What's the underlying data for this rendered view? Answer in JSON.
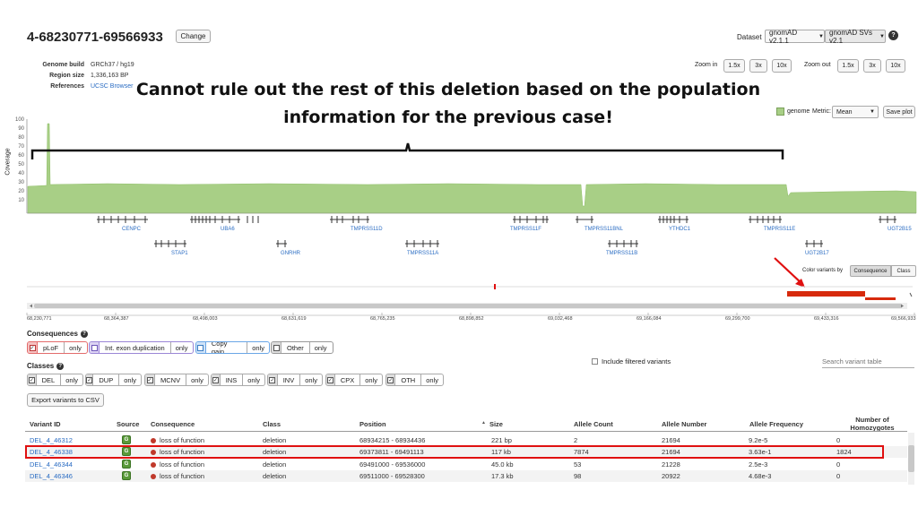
{
  "header": {
    "region_title": "4-68230771-69566933",
    "change_label": "Change",
    "dataset_label": "Dataset",
    "dataset_value": "gnomAD v2.1.1",
    "sv_dataset_value": "gnomAD SVs v2.1",
    "help_glyph": "?"
  },
  "meta": {
    "genome_build_label": "Genome build",
    "genome_build_value": "GRCh37 / hg19",
    "region_size_label": "Region size",
    "region_size_value": "1,336,163 BP",
    "references_label": "References",
    "references_value": "UCSC Browser"
  },
  "zoom": {
    "zoom_in_label": "Zoom in",
    "zoom_out_label": "Zoom out",
    "levels": [
      "1.5x",
      "3x",
      "10x"
    ]
  },
  "overlay": {
    "caption_line1": "Cannot rule out the rest of this deletion based on the population",
    "caption_line2": "information for the previous case!"
  },
  "coverage": {
    "axis_label": "Coverage",
    "y_ticks": [
      "100",
      "90",
      "80",
      "70",
      "60",
      "50",
      "40",
      "30",
      "20",
      "10"
    ],
    "legend_label": "genome",
    "metric_label": "Metric:",
    "metric_value": "Mean",
    "save_plot_label": "Save plot",
    "colors": {
      "fill": "#a8cf86",
      "stroke": "#8fbf68"
    }
  },
  "genes": {
    "row1": [
      "CENPC",
      "UBA6",
      "TMPRSS11D",
      "TMPRSS11F",
      "TMPRSS11BNL",
      "YTHDC1",
      "TMPRSS11E",
      "UGT2B15"
    ],
    "row2": [
      "STAP1",
      "GNRHR",
      "TMPRSS11A",
      "TMPRSS11B",
      "UGT2B17"
    ]
  },
  "track": {
    "color_variants_label": "Color variants by",
    "consequence_toggle": "Consequence",
    "class_toggle": "Class",
    "x_ticks": [
      "68,230,771",
      "68,364,387",
      "68,498,003",
      "68,631,619",
      "68,765,235",
      "68,898,852",
      "69,032,468",
      "69,166,084",
      "69,299,700",
      "69,433,316",
      "69,566,933"
    ]
  },
  "filters": {
    "consequences_title": "Consequences",
    "classes_title": "Classes",
    "only_label": "only",
    "consequences": [
      {
        "label": "pLoF",
        "color": "#e36b6b"
      },
      {
        "label": "Int. exon duplication",
        "color": "#9b86d6"
      },
      {
        "label": "Copy gain",
        "color": "#6aa6e6"
      },
      {
        "label": "Other",
        "color": "#999999"
      }
    ],
    "classes": [
      "DEL",
      "DUP",
      "MCNV",
      "INS",
      "INV",
      "CPX",
      "OTH"
    ],
    "export_label": "Export variants to CSV",
    "include_filtered_label": "Include filtered variants",
    "search_placeholder": "Search variant table"
  },
  "table": {
    "headers": {
      "variant_id": "Variant ID",
      "source": "Source",
      "consequence": "Consequence",
      "class": "Class",
      "position": "Position",
      "size": "Size",
      "allele_count": "Allele Count",
      "allele_number": "Allele Number",
      "allele_frequency": "Allele Frequency",
      "homozygotes_line1": "Number of",
      "homozygotes_line2": "Homozygotes",
      "sort_glyph": "▲"
    },
    "source_glyph": "G",
    "rows": [
      {
        "variant_id": "DEL_4_46312",
        "consequence": "loss of function",
        "class": "deletion",
        "position": "68934215 - 68934436",
        "size": "221 bp",
        "allele_count": "2",
        "allele_number": "21694",
        "allele_frequency": "9.2e-5",
        "homozygotes": "0"
      },
      {
        "variant_id": "DEL_4_46338",
        "consequence": "loss of function",
        "class": "deletion",
        "position": "69373811 - 69491113",
        "size": "117 kb",
        "allele_count": "7874",
        "allele_number": "21694",
        "allele_frequency": "3.63e-1",
        "homozygotes": "1824"
      },
      {
        "variant_id": "DEL_4_46344",
        "consequence": "loss of function",
        "class": "deletion",
        "position": "69491000 - 69536000",
        "size": "45.0 kb",
        "allele_count": "53",
        "allele_number": "21228",
        "allele_frequency": "2.5e-3",
        "homozygotes": "0"
      },
      {
        "variant_id": "DEL_4_46346",
        "consequence": "loss of function",
        "class": "deletion",
        "position": "69511000 - 69528300",
        "size": "17.3 kb",
        "allele_count": "98",
        "allele_number": "20922",
        "allele_frequency": "4.68e-3",
        "homozygotes": "0"
      }
    ]
  }
}
